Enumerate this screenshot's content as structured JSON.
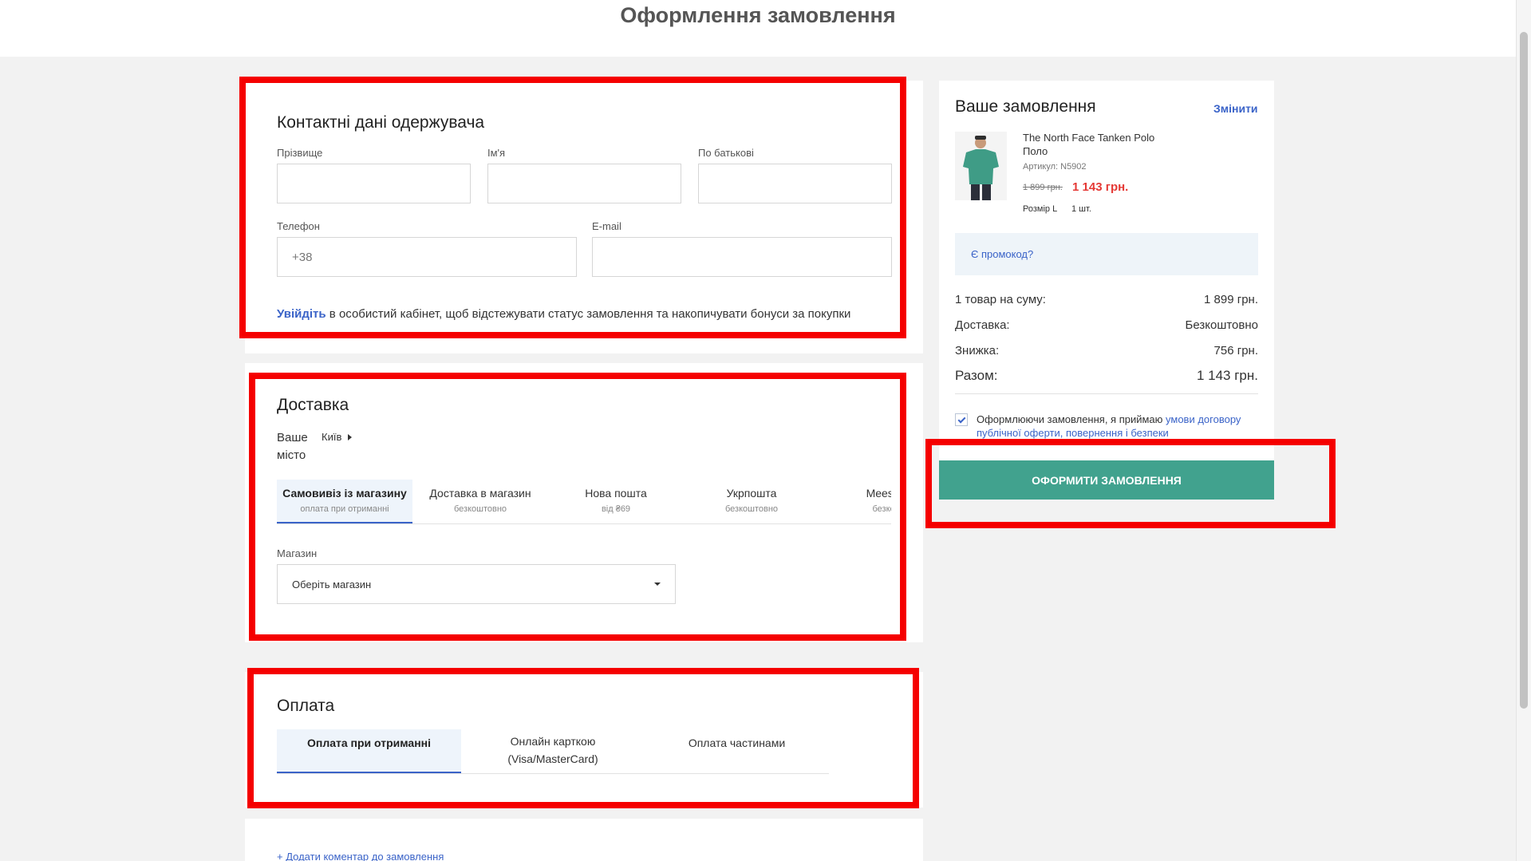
{
  "page": {
    "title": "Оформлення замовлення"
  },
  "contact": {
    "title": "Контактні дані одержувача",
    "surname_label": "Прізвище",
    "name_label": "Ім'я",
    "patronymic_label": "По батькові",
    "phone_label": "Телефон",
    "phone_value": "+38",
    "email_label": "E-mail",
    "login_link": "Увійдіть",
    "login_text": " в особистий кабінет, щоб відстежувати статус замовлення та накопичувати бонуси за покупки"
  },
  "delivery": {
    "title": "Доставка",
    "city_label": "Ваше місто",
    "city_value": "Київ",
    "tabs": [
      {
        "label": "Самовивіз із магазину",
        "sub": "оплата при отриманні",
        "active": true
      },
      {
        "label": "Доставка в магазин",
        "sub": "безкоштовно",
        "active": false
      },
      {
        "label": "Нова пошта",
        "sub": "від ₴69",
        "active": false
      },
      {
        "label": "Укрпошта",
        "sub": "безкоштовно",
        "active": false
      },
      {
        "label": "Meest-П",
        "sub": "безкош",
        "active": false
      }
    ],
    "store_label": "Магазин",
    "store_placeholder": "Оберіть магазин"
  },
  "payment": {
    "title": "Оплата",
    "tabs": [
      {
        "label": "Оплата при отриманні",
        "active": true
      },
      {
        "label": "Онлайн карткою (Visa/MasterCard)",
        "active": false
      },
      {
        "label": "Оплата частинами",
        "active": false
      }
    ]
  },
  "comment": {
    "link": "+ Додати коментар до замовлення"
  },
  "order": {
    "title": "Ваше замовлення",
    "change_link": "Змінити",
    "item": {
      "name": "The North Face Tanken Polo Поло",
      "sku": "Артикул: N5902",
      "old_price": "1 899 грн.",
      "new_price": "1 143 грн.",
      "size": "Розмір L",
      "qty": "1 шт."
    },
    "promo": "Є промокод?",
    "rows": [
      {
        "label": "1 товар на суму:",
        "value": "1 899 грн."
      },
      {
        "label": "Доставка:",
        "value": "Безкоштовно"
      },
      {
        "label": "Знижка:",
        "value": "756 грн."
      }
    ],
    "total_label": "Разом:",
    "total_value": "1 143 грн.",
    "agree_text": "Оформлюючи замовлення, я приймаю ",
    "agree_link": "умови договору публічної оферти, повернення і безпеки",
    "submit": "ОФОРМИТИ ЗАМОВЛЕННЯ"
  },
  "colors": {
    "accent": "#3a63c8",
    "submit_bg": "#41a28e",
    "price_red": "#e53935",
    "highlight": "#f50000"
  }
}
